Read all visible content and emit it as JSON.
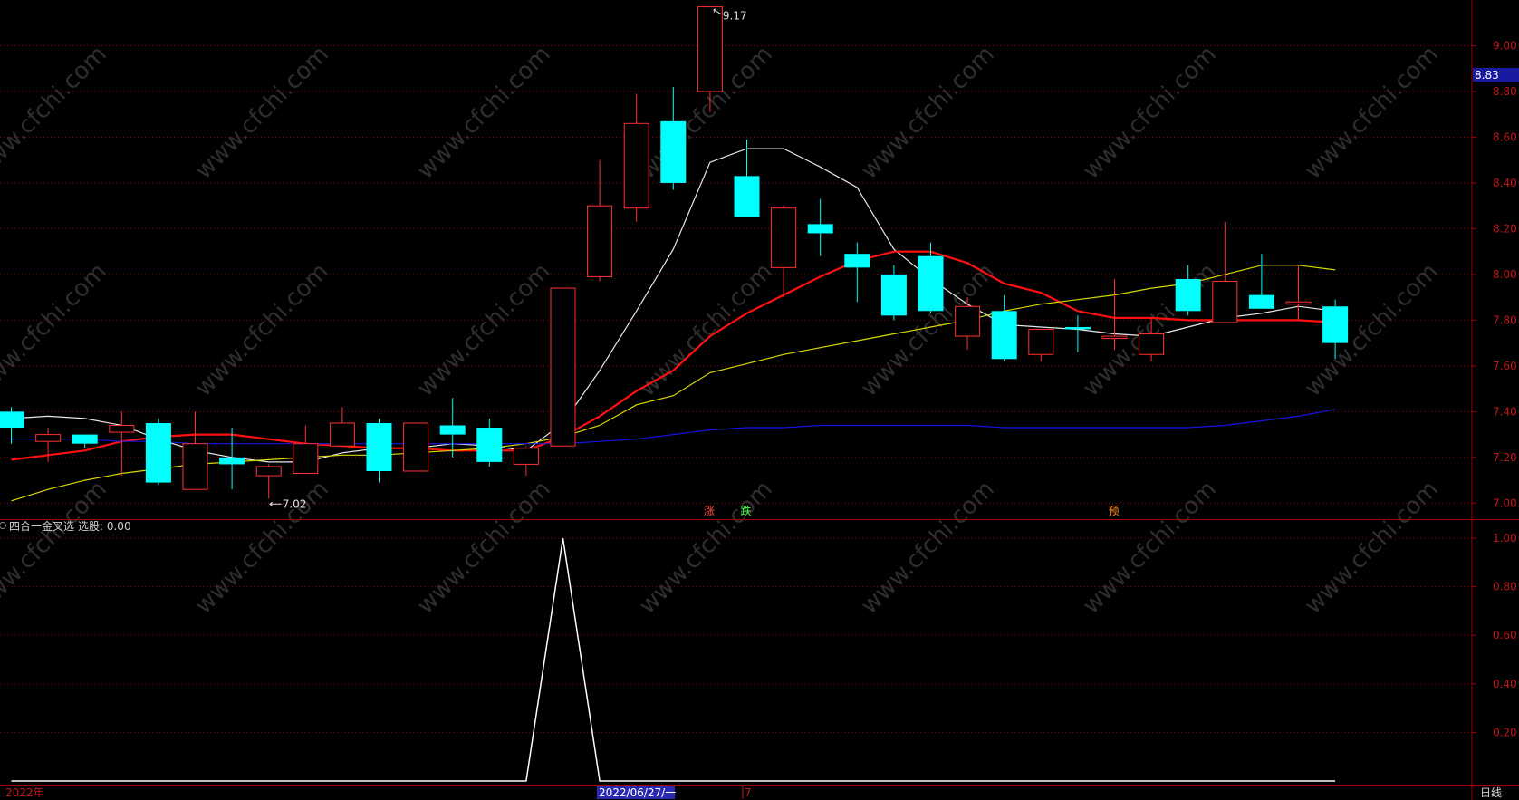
{
  "colors": {
    "background": "#000000",
    "frame": "#a00000",
    "grid": "#8b0000",
    "axis_text": "#c01818",
    "up_candle": "#ff3030",
    "down_candle": "#00ffff",
    "ma_white": "#e8e8e8",
    "ma_red": "#ff1010",
    "ma_yellow": "#d8d800",
    "ma_blue": "#1414e0",
    "indicator_line": "#ffffff",
    "current_price_bg": "#1a1aa0",
    "date_highlight_bg": "#2a2ab0",
    "watermark": "#2e2e2e"
  },
  "watermark_text": "www.cfchi.com",
  "main_panel": {
    "y_ticks": [
      "9.00",
      "8.80",
      "8.60",
      "8.40",
      "8.20",
      "8.00",
      "7.80",
      "7.60",
      "7.40",
      "7.20",
      "7.00"
    ],
    "current_price_label": "8.83",
    "high_annotation": "9.17",
    "low_annotation": "7.02",
    "signal_markers": [
      {
        "text": "涨",
        "index": 19,
        "color": "#ff5040"
      },
      {
        "text": "跌",
        "index": 20,
        "color": "#40ff40"
      },
      {
        "text": "预",
        "index": 30,
        "color": "#ff9020"
      }
    ]
  },
  "indicator_panel": {
    "title": "四合一金叉选",
    "value_label": "选股: 0.00",
    "y_ticks": [
      "1.00",
      "0.80",
      "0.60",
      "0.40",
      "0.20"
    ]
  },
  "bottom_bar": {
    "year_label": "2022年",
    "date_label": "2022/06/27/一",
    "month_label": "7",
    "period_label": "日线"
  },
  "chart_data": [
    {
      "type": "candlestick",
      "title": "",
      "ylim": [
        6.93,
        9.2
      ],
      "grid": true,
      "candles": [
        {
          "o": 7.4,
          "h": 7.42,
          "l": 7.26,
          "c": 7.33
        },
        {
          "o": 7.27,
          "h": 7.33,
          "l": 7.18,
          "c": 7.3
        },
        {
          "o": 7.3,
          "h": 7.3,
          "l": 7.24,
          "c": 7.26
        },
        {
          "o": 7.31,
          "h": 7.4,
          "l": 7.12,
          "c": 7.34
        },
        {
          "o": 7.35,
          "h": 7.37,
          "l": 7.08,
          "c": 7.09
        },
        {
          "o": 7.06,
          "h": 7.4,
          "l": 7.06,
          "c": 7.26
        },
        {
          "o": 7.2,
          "h": 7.33,
          "l": 7.06,
          "c": 7.17
        },
        {
          "o": 7.12,
          "h": 7.17,
          "l": 7.02,
          "c": 7.16
        },
        {
          "o": 7.13,
          "h": 7.34,
          "l": 7.13,
          "c": 7.26
        },
        {
          "o": 7.25,
          "h": 7.42,
          "l": 7.25,
          "c": 7.35
        },
        {
          "o": 7.35,
          "h": 7.37,
          "l": 7.09,
          "c": 7.14
        },
        {
          "o": 7.14,
          "h": 7.35,
          "l": 7.14,
          "c": 7.35
        },
        {
          "o": 7.34,
          "h": 7.46,
          "l": 7.2,
          "c": 7.3
        },
        {
          "o": 7.33,
          "h": 7.37,
          "l": 7.16,
          "c": 7.18
        },
        {
          "o": 7.17,
          "h": 7.25,
          "l": 7.12,
          "c": 7.24
        },
        {
          "o": 7.25,
          "h": 7.94,
          "l": 7.25,
          "c": 7.94
        },
        {
          "o": 7.99,
          "h": 8.5,
          "l": 7.97,
          "c": 8.3
        },
        {
          "o": 8.29,
          "h": 8.79,
          "l": 8.23,
          "c": 8.66
        },
        {
          "o": 8.67,
          "h": 8.82,
          "l": 8.37,
          "c": 8.4
        },
        {
          "o": 8.8,
          "h": 9.17,
          "l": 8.71,
          "c": 9.17
        },
        {
          "o": 8.43,
          "h": 8.59,
          "l": 8.25,
          "c": 8.25
        },
        {
          "o": 8.03,
          "h": 8.3,
          "l": 7.9,
          "c": 8.29
        },
        {
          "o": 8.22,
          "h": 8.33,
          "l": 8.08,
          "c": 8.18
        },
        {
          "o": 8.09,
          "h": 8.14,
          "l": 7.88,
          "c": 8.03
        },
        {
          "o": 8.0,
          "h": 8.04,
          "l": 7.8,
          "c": 7.82
        },
        {
          "o": 8.08,
          "h": 8.14,
          "l": 7.83,
          "c": 7.84
        },
        {
          "o": 7.73,
          "h": 7.9,
          "l": 7.67,
          "c": 7.86
        },
        {
          "o": 7.84,
          "h": 7.91,
          "l": 7.62,
          "c": 7.63
        },
        {
          "o": 7.65,
          "h": 7.76,
          "l": 7.62,
          "c": 7.76
        },
        {
          "o": 7.77,
          "h": 7.82,
          "l": 7.66,
          "c": 7.76
        },
        {
          "o": 7.72,
          "h": 7.98,
          "l": 7.67,
          "c": 7.73
        },
        {
          "o": 7.65,
          "h": 7.81,
          "l": 7.62,
          "c": 7.74
        },
        {
          "o": 7.98,
          "h": 8.04,
          "l": 7.82,
          "c": 7.84
        },
        {
          "o": 7.79,
          "h": 8.23,
          "l": 7.79,
          "c": 7.97
        },
        {
          "o": 7.91,
          "h": 8.09,
          "l": 7.85,
          "c": 7.85
        },
        {
          "o": 7.87,
          "h": 8.04,
          "l": 7.8,
          "c": 7.88
        },
        {
          "o": 7.86,
          "h": 7.89,
          "l": 7.63,
          "c": 7.7
        }
      ],
      "moving_averages": [
        {
          "color_key": "ma_white",
          "values": [
            7.37,
            7.38,
            7.37,
            7.34,
            7.28,
            7.23,
            7.2,
            7.18,
            7.18,
            7.22,
            7.24,
            7.24,
            7.26,
            7.25,
            7.23,
            7.35,
            7.58,
            7.84,
            8.11,
            8.49,
            8.55,
            8.55,
            8.47,
            8.38,
            8.11,
            7.98,
            7.87,
            7.78,
            7.77,
            7.76,
            7.74,
            7.73,
            7.77,
            7.81,
            7.83,
            7.86,
            7.84
          ]
        },
        {
          "color_key": "ma_red",
          "values": [
            7.19,
            7.21,
            7.23,
            7.27,
            7.29,
            7.3,
            7.3,
            7.28,
            7.26,
            7.25,
            7.24,
            7.24,
            7.23,
            7.23,
            7.23,
            7.29,
            7.38,
            7.49,
            7.58,
            7.73,
            7.83,
            7.91,
            7.99,
            8.06,
            8.1,
            8.1,
            8.05,
            7.96,
            7.92,
            7.84,
            7.81,
            7.81,
            7.8,
            7.8,
            7.8,
            7.8,
            7.79
          ]
        },
        {
          "color_key": "ma_yellow",
          "values": [
            7.01,
            7.06,
            7.1,
            7.13,
            7.15,
            7.17,
            7.18,
            7.19,
            7.2,
            7.21,
            7.21,
            7.22,
            7.23,
            7.24,
            7.26,
            7.29,
            7.34,
            7.43,
            7.47,
            7.57,
            7.61,
            7.65,
            7.68,
            7.71,
            7.74,
            7.77,
            7.8,
            7.84,
            7.87,
            7.89,
            7.91,
            7.94,
            7.96,
            8.0,
            8.04,
            8.04,
            8.02
          ]
        },
        {
          "color_key": "ma_blue",
          "values": [
            7.28,
            7.28,
            7.28,
            7.27,
            7.27,
            7.26,
            7.26,
            7.26,
            7.26,
            7.26,
            7.26,
            7.26,
            7.26,
            7.26,
            7.26,
            7.26,
            7.27,
            7.28,
            7.3,
            7.32,
            7.33,
            7.33,
            7.34,
            7.34,
            7.34,
            7.34,
            7.34,
            7.33,
            7.33,
            7.33,
            7.33,
            7.33,
            7.33,
            7.34,
            7.36,
            7.38,
            7.41
          ]
        }
      ]
    },
    {
      "type": "line",
      "title": "四合一金叉选",
      "ylim": [
        0,
        1.0
      ],
      "grid": true,
      "series": [
        {
          "name": "选股",
          "values": [
            0,
            0,
            0,
            0,
            0,
            0,
            0,
            0,
            0,
            0,
            0,
            0,
            0,
            0,
            0,
            1,
            0,
            0,
            0,
            0,
            0,
            0,
            0,
            0,
            0,
            0,
            0,
            0,
            0,
            0,
            0,
            0,
            0,
            0,
            0,
            0,
            0
          ]
        }
      ]
    }
  ]
}
